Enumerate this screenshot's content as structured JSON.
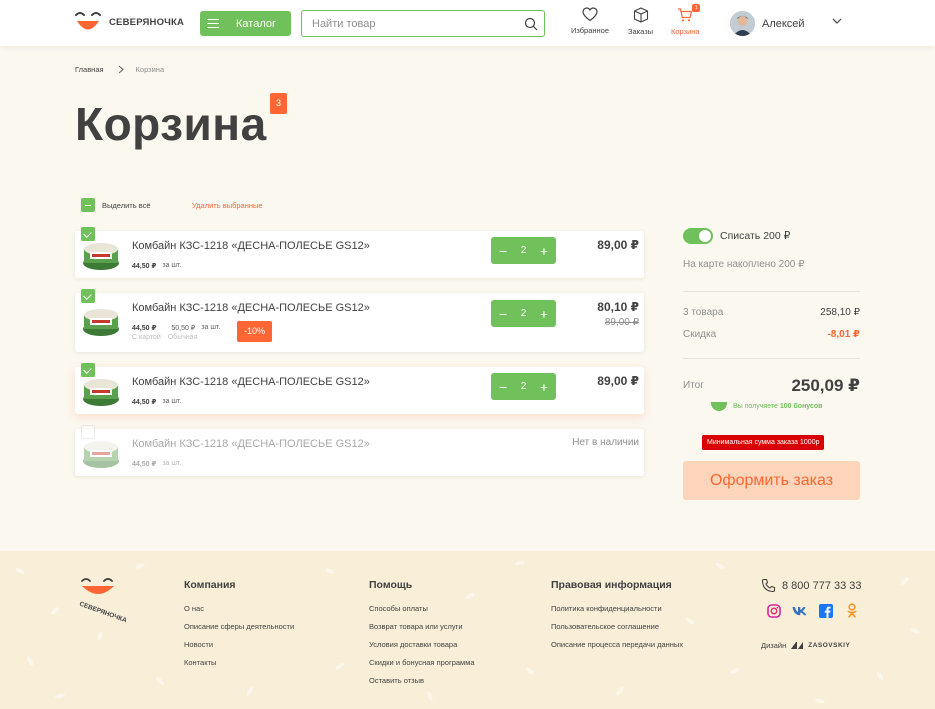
{
  "header": {
    "brand": "СЕВЕРЯНОЧКА",
    "catalog_label": "Каталог",
    "search_placeholder": "Найти товар",
    "nav": {
      "favorites": "Избранное",
      "orders": "Заказы",
      "cart": "Корзина",
      "cart_count": "1"
    },
    "user_name": "Алексей"
  },
  "breadcrumb": {
    "home": "Главная",
    "current": "Корзина"
  },
  "page": {
    "title": "Корзина",
    "count_badge": "3"
  },
  "selection": {
    "select_all": "Выделить всё",
    "delete_selected": "Удалить выбранные"
  },
  "items": [
    {
      "name": "Комбайн КЗС-1218 «ДЕСНА-ПОЛЕСЬЕ GS12»",
      "price": "44,50 ₽",
      "unit": "за шт.",
      "qty": "2",
      "total": "89,00 ₽"
    },
    {
      "name": "Комбайн КЗС-1218 «ДЕСНА-ПОЛЕСЬЕ GS12»",
      "price": "44,50 ₽",
      "regular_price": "50,50 ₽",
      "unit": "за шт.",
      "card_label": "С картой",
      "regular_label": "Обычная",
      "discount": "-10%",
      "qty": "2",
      "total": "80,10 ₽",
      "old_total": "89,00 ₽"
    },
    {
      "name": "Комбайн КЗС-1218 «ДЕСНА-ПОЛЕСЬЕ GS12»",
      "price": "44,50 ₽",
      "unit": "за шт.",
      "qty": "2",
      "total": "89,00 ₽"
    },
    {
      "name": "Комбайн КЗС-1218 «ДЕСНА-ПОЛЕСЬЕ GS12»",
      "price": "44,50 ₽",
      "unit": "за шт.",
      "status": "Нет в наличии"
    }
  ],
  "summary": {
    "bonus_toggle": "Списать 200 ₽",
    "bonus_info": "На карте накоплено 200 ₽",
    "items_label": "3 товара",
    "items_value": "258,10 ₽",
    "discount_label": "Скидка",
    "discount_value": "-8,01 ₽",
    "total_label": "Итог",
    "total_value": "250,09 ₽",
    "earn_prefix": "Вы получяете",
    "earn_bonus": "100 бонусов",
    "min_order": "Минимальная сумма заказа 1000р",
    "checkout": "Оформить заказ"
  },
  "footer": {
    "logo_text": "СЕВЕРЯНОЧКА",
    "columns": [
      {
        "title": "Компания",
        "links": [
          "О нас",
          "Описание сферы деятельности",
          "Новости",
          "Контакты"
        ]
      },
      {
        "title": "Помощь",
        "links": [
          "Способы оплаты",
          "Возврат товара или услуги",
          "Условия доставки товара",
          "Скидки и бонусная программа",
          "Оставить отзыв"
        ]
      },
      {
        "title": "Правовая информация",
        "links": [
          "Политика конфиденциальности",
          "Пользовательское соглашение",
          "Описание процесса передачи данных"
        ]
      }
    ],
    "phone": "8 800 777 33 33",
    "socials": [
      "instagram-icon",
      "vk-icon",
      "facebook-icon",
      "odnoklassniki-icon"
    ],
    "design_label": "Дизайн",
    "design_studio": "ZASOVSKIY"
  },
  "colors": {
    "green": "#70c05b",
    "orange": "#ff6633",
    "red": "#d80000",
    "background": "#fbf8f0",
    "footer_bg": "#f9efd9"
  }
}
